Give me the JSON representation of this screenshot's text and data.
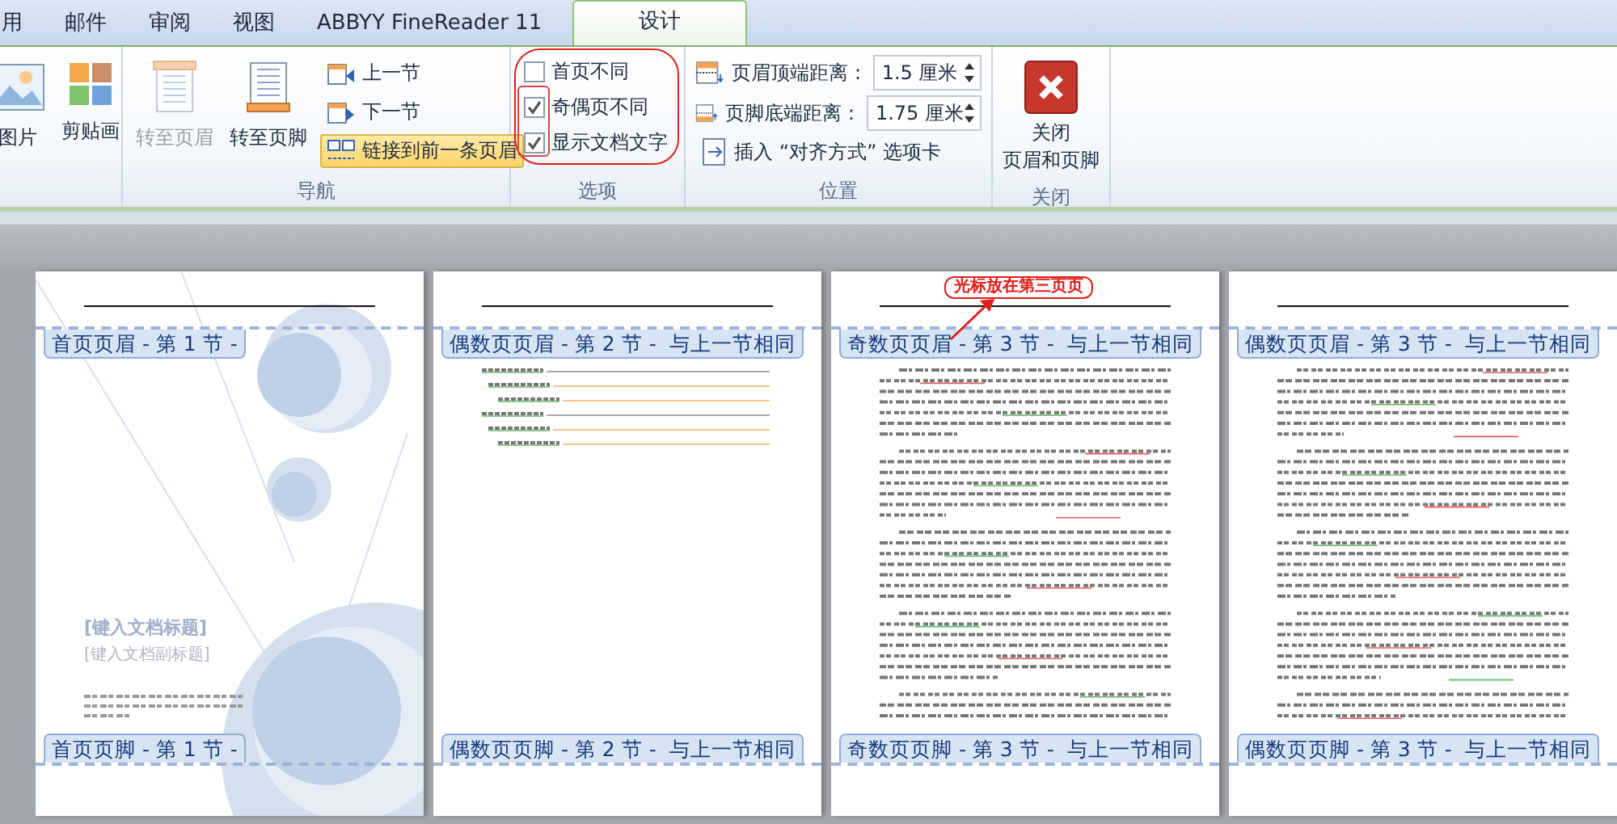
{
  "tabs": [
    {
      "label": "用",
      "selected": false
    },
    {
      "label": "邮件",
      "selected": false
    },
    {
      "label": "审阅",
      "selected": false
    },
    {
      "label": "视图",
      "selected": false
    },
    {
      "label": "ABBYY FineReader 11",
      "selected": false
    },
    {
      "label": "设计",
      "selected": true
    }
  ],
  "ribbon": {
    "groups": [
      {
        "kind": "insert",
        "buttons": [
          {
            "label": "图片"
          },
          {
            "label": "剪贴画"
          }
        ]
      },
      {
        "kind": "navigation",
        "label": "导航",
        "large_buttons": [
          {
            "label": "转至页眉",
            "disabled": true
          },
          {
            "label": "转至页脚",
            "disabled": false
          }
        ],
        "small_buttons": [
          {
            "label": "上一节",
            "on": false
          },
          {
            "label": "下一节",
            "on": false
          },
          {
            "label": "链接到前一条页眉",
            "on": true
          }
        ]
      },
      {
        "kind": "options",
        "label": "选项",
        "checkboxes": [
          {
            "label": "首页不同",
            "checked": false
          },
          {
            "label": "奇偶页不同",
            "checked": true
          },
          {
            "label": "显示文档文字",
            "checked": true
          }
        ]
      },
      {
        "kind": "position",
        "label": "位置",
        "spinners": [
          {
            "label": "页眉顶端距离：",
            "value": "1.5 厘米"
          },
          {
            "label": "页脚底端距离：",
            "value": "1.75 厘米"
          }
        ],
        "link": "插入 “对齐方式” 选项卡"
      },
      {
        "kind": "close",
        "label": "关闭",
        "button_lines": [
          "关闭",
          "页眉和页脚"
        ]
      }
    ]
  },
  "pages": [
    {
      "kind": "cover",
      "header_label": "首页页眉 - 第 1 节 -",
      "footer_label": "首页页脚 - 第 1 节 -",
      "title": "[键入文档标题]",
      "subtitle": "[键入文档副标题]"
    },
    {
      "kind": "toc",
      "header_label": "偶数页页眉 - 第 2 节 -  与上一节相同",
      "footer_label": "偶数页页脚 - 第 2 节 -  与上一节相同"
    },
    {
      "kind": "text",
      "header_label": "奇数页页眉 - 第 3 节 -  与上一节相同",
      "footer_label": "奇数页页脚 - 第 3 节 -  与上一节相同",
      "callout": "光标放在第三页页"
    },
    {
      "kind": "text",
      "header_label": "偶数页页眉 - 第 3 节 -  与上一节相同",
      "footer_label": "偶数页页脚 - 第 3 节 -  与上一节相同"
    }
  ]
}
